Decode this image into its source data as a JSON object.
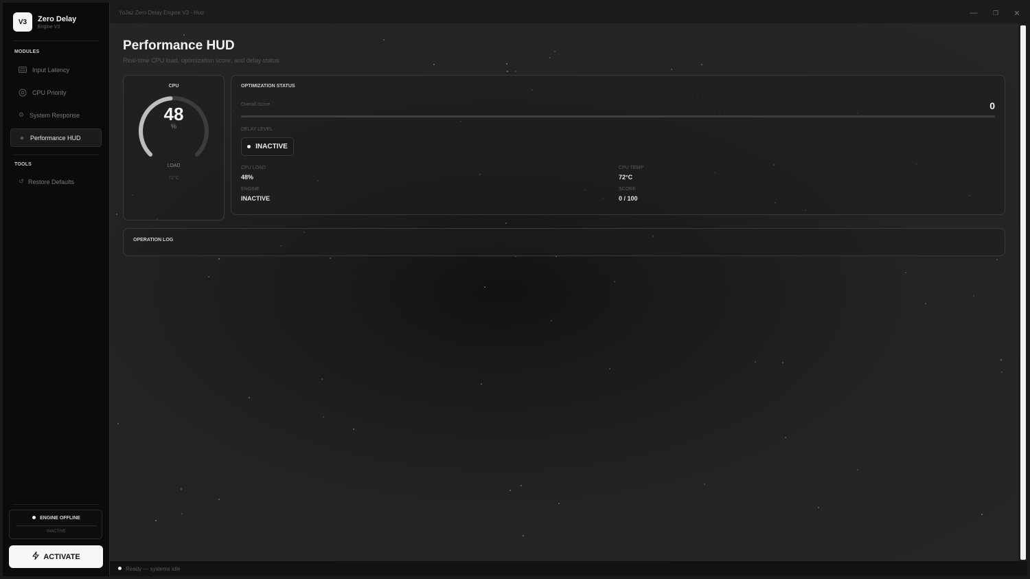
{
  "window": {
    "title": "YoJaz Zero Delay Engine V3 - Hud",
    "controls": {
      "minimize": "—",
      "maximize": "❐",
      "close": "✕"
    }
  },
  "brand": {
    "logo_text": "V3",
    "name": "Zero Delay",
    "subtitle": "Engine V3"
  },
  "sidebar": {
    "modules_label": "MODULES",
    "items": [
      {
        "label": "Input Latency",
        "icon": "keyboard-icon"
      },
      {
        "label": "CPU Priority",
        "icon": "cpu-icon"
      },
      {
        "label": "System Response",
        "icon": "gear-icon"
      },
      {
        "label": "Performance HUD",
        "icon": "diamond-icon",
        "active": true
      }
    ],
    "tools_label": "TOOLS",
    "tools": [
      {
        "label": "Restore Defaults",
        "icon": "restore-icon"
      }
    ],
    "engine": {
      "status": "ENGINE OFFLINE",
      "sub": "INACTIVE"
    },
    "activate_label": "ACTIVATE"
  },
  "page": {
    "title": "Performance HUD",
    "subtitle": "Real-time CPU load, optimization score, and delay status"
  },
  "cpu_card": {
    "label": "CPU",
    "value": "48",
    "unit": "%",
    "load_label": "LOAD",
    "temp": "72°C",
    "gauge_fraction": 0.48
  },
  "optimization": {
    "title": "OPTIMIZATION STATUS",
    "overall_label": "Overall Score",
    "overall_value": "0",
    "overall_fraction": 0,
    "delay_label": "DELAY LEVEL",
    "delay_value": "INACTIVE",
    "metrics": {
      "cpu_load_label": "CPU LOAD",
      "cpu_load_value": "48%",
      "cpu_temp_label": "CPU TEMP",
      "cpu_temp_value": "72°C",
      "engine_label": "ENGINE",
      "engine_value": "INACTIVE",
      "score_label": "SCORE",
      "score_value": "0 / 100"
    }
  },
  "log": {
    "title": "OPERATION LOG"
  },
  "statusbar": {
    "text": "Ready — systems idle"
  },
  "colors": {
    "accent": "#f4f4f4",
    "background": "#202020",
    "sidebar": "#0b0b0b"
  }
}
